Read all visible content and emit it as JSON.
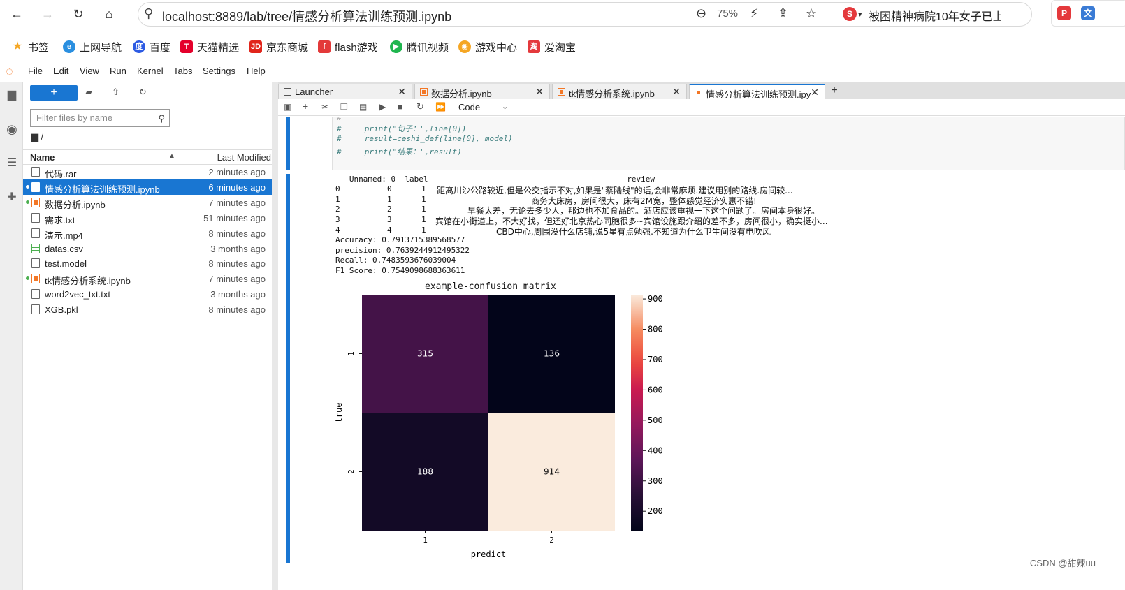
{
  "browser": {
    "url": "localhost:8889/lab/tree/情感分析算法训练预测.ipynb",
    "zoom": "75%",
    "news": "被困精神病院10年女子已上",
    "bookmarks": [
      "书签",
      "上网导航",
      "百度",
      "天猫精选",
      "京东商城",
      "flash游戏",
      "腾讯视频",
      "游戏中心",
      "爱淘宝"
    ]
  },
  "menu": [
    "File",
    "Edit",
    "View",
    "Run",
    "Kernel",
    "Tabs",
    "Settings",
    "Help"
  ],
  "filebrowser": {
    "new_label": "+",
    "filter_placeholder": "Filter files by name",
    "path": "/",
    "col_name": "Name",
    "col_modified": "Last Modified",
    "files": [
      {
        "name": "代码.rar",
        "modified": "2 minutes ago",
        "type": "file",
        "running": false,
        "selected": false
      },
      {
        "name": "情感分析算法训练预测.ipynb",
        "modified": "6 minutes ago",
        "type": "notebook",
        "running": true,
        "selected": true
      },
      {
        "name": "数据分析.ipynb",
        "modified": "7 minutes ago",
        "type": "notebook",
        "running": true,
        "selected": false
      },
      {
        "name": "需求.txt",
        "modified": "51 minutes ago",
        "type": "file",
        "running": false,
        "selected": false
      },
      {
        "name": "演示.mp4",
        "modified": "8 minutes ago",
        "type": "file",
        "running": false,
        "selected": false
      },
      {
        "name": "datas.csv",
        "modified": "3 months ago",
        "type": "csv",
        "running": false,
        "selected": false
      },
      {
        "name": "test.model",
        "modified": "8 minutes ago",
        "type": "file",
        "running": false,
        "selected": false
      },
      {
        "name": "tk情感分析系统.ipynb",
        "modified": "7 minutes ago",
        "type": "notebook",
        "running": true,
        "selected": false
      },
      {
        "name": "word2vec_txt.txt",
        "modified": "3 months ago",
        "type": "file",
        "running": false,
        "selected": false
      },
      {
        "name": "XGB.pkl",
        "modified": "8 minutes ago",
        "type": "file",
        "running": false,
        "selected": false
      }
    ]
  },
  "tabs": [
    {
      "label": "Launcher",
      "active": false
    },
    {
      "label": "数据分析.ipynb",
      "active": false
    },
    {
      "label": "tk情感分析系统.ipynb",
      "active": false
    },
    {
      "label": "情感分析算法训练预测.ipynb",
      "active": true
    }
  ],
  "toolbar": {
    "cell_type": "Code"
  },
  "code": [
    "#     print(\"句子：\",line[0])",
    "#     result=ceshi_def(line[0], model)",
    "#     print(\"结果：\",result)"
  ],
  "output": {
    "df_header": "   Unnamed: 0  label                                           review",
    "df_rows": [
      {
        "idx": "0",
        "unnamed": "0",
        "label": "1",
        "review": "距离川沙公路较近,但是公交指示不对,如果是\"蔡陆线\"的话,会非常麻烦.建议用别的路线.房间较..."
      },
      {
        "idx": "1",
        "unnamed": "1",
        "label": "1",
        "review": "商务大床房，房间很大，床有2M宽，整体感觉经济实惠不错!"
      },
      {
        "idx": "2",
        "unnamed": "2",
        "label": "1",
        "review": "早餐太差，无论去多少人，那边也不加食品的。酒店应该重视一下这个问题了。房间本身很好。"
      },
      {
        "idx": "3",
        "unnamed": "3",
        "label": "1",
        "review": "宾馆在小街道上，不大好找，但还好北京热心同胞很多~宾馆设施跟介绍的差不多，房间很小，确实挺小..."
      },
      {
        "idx": "4",
        "unnamed": "4",
        "label": "1",
        "review": "CBD中心,周围没什么店铺,说5星有点勉强.不知道为什么卫生间没有电吹风"
      }
    ],
    "metrics": [
      "Accuracy: 0.7913715389568577",
      "precision: 0.7639244912495322",
      "Recall: 0.7483593676039004",
      "F1 Score: 0.7549098688363611"
    ]
  },
  "chart_data": {
    "type": "heatmap",
    "title": "example-confusion matrix",
    "xlabel": "predict",
    "ylabel": "true",
    "x_categories": [
      "1",
      "2"
    ],
    "y_categories": [
      "1",
      "2"
    ],
    "values": [
      [
        315,
        136
      ],
      [
        188,
        914
      ]
    ],
    "colorbar": {
      "min": 136,
      "max": 914,
      "ticks": [
        200,
        300,
        400,
        500,
        600,
        700,
        800,
        900
      ]
    },
    "colormap": "rocket"
  },
  "watermark": "CSDN @甜辣uu"
}
